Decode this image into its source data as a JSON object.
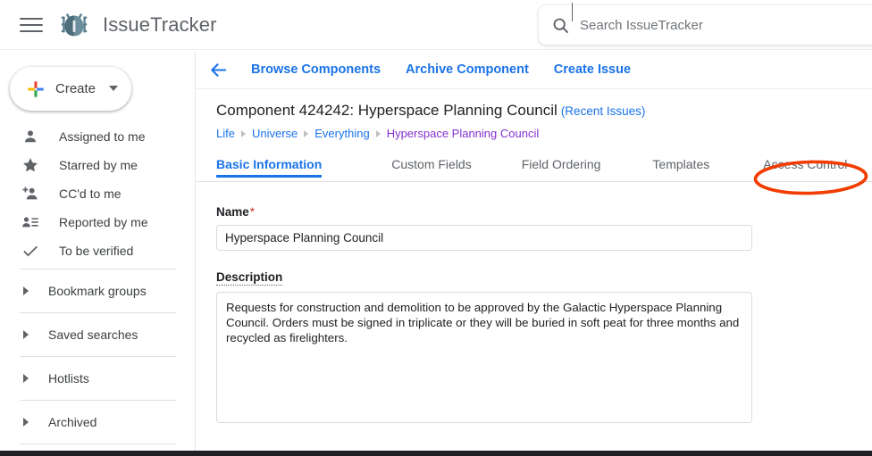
{
  "topbar": {
    "menu_icon": "hamburger-menu-icon",
    "logo_icon": "bug-logo-icon",
    "brand_title": "IssueTracker",
    "search": {
      "icon": "search-icon",
      "placeholder": "Search IssueTracker",
      "value": ""
    }
  },
  "sidebar": {
    "create": {
      "label": "Create",
      "plus_icon": "plus-icon",
      "caret_icon": "chevron-down-icon"
    },
    "items": [
      {
        "label": "Assigned to me",
        "icon": "person-icon"
      },
      {
        "label": "Starred by me",
        "icon": "star-icon"
      },
      {
        "label": "CC'd to me",
        "icon": "person-add-icon"
      },
      {
        "label": "Reported by me",
        "icon": "person-list-icon"
      },
      {
        "label": "To be verified",
        "icon": "check-icon"
      }
    ],
    "groups": [
      {
        "label": "Bookmark groups",
        "icon": "triangle-right-icon"
      },
      {
        "label": "Saved searches",
        "icon": "triangle-right-icon"
      },
      {
        "label": "Hotlists",
        "icon": "triangle-right-icon"
      },
      {
        "label": "Archived",
        "icon": "triangle-right-icon"
      }
    ]
  },
  "main": {
    "back_icon": "back-arrow-icon",
    "actions": [
      "Browse Components",
      "Archive Component",
      "Create Issue"
    ],
    "page_title": "Component 424242: Hyperspace Planning Council",
    "recent_issues": "(Recent Issues)",
    "breadcrumb": [
      {
        "label": "Life",
        "current": false
      },
      {
        "label": "Universe",
        "current": false
      },
      {
        "label": "Everything",
        "current": false
      },
      {
        "label": "Hyperspace Planning Council",
        "current": true
      }
    ],
    "tabs": [
      {
        "label": "Basic Information",
        "active": true
      },
      {
        "label": "Custom Fields",
        "active": false
      },
      {
        "label": "Field Ordering",
        "active": false
      },
      {
        "label": "Templates",
        "active": false
      },
      {
        "label": "Access Control",
        "active": false
      }
    ],
    "form": {
      "name_label": "Name",
      "name_required": "*",
      "name_value": "Hyperspace Planning Council",
      "description_label": "Description",
      "description_value": "Requests for construction and demolition to be approved by the Galactic Hyperspace Planning Council. Orders must be signed in triplicate or they will be buried in soft peat for three months and recycled as firelighters."
    }
  },
  "annotation": {
    "target": "Access Control",
    "shape": "ellipse",
    "color": "#f23c00"
  },
  "colors": {
    "link_blue": "#1a73e8",
    "breadcrumb_purple": "#8430ce",
    "text_primary": "#202124",
    "text_secondary": "#5f6368",
    "border": "#dadce0",
    "annotation_red": "#f23c00"
  }
}
